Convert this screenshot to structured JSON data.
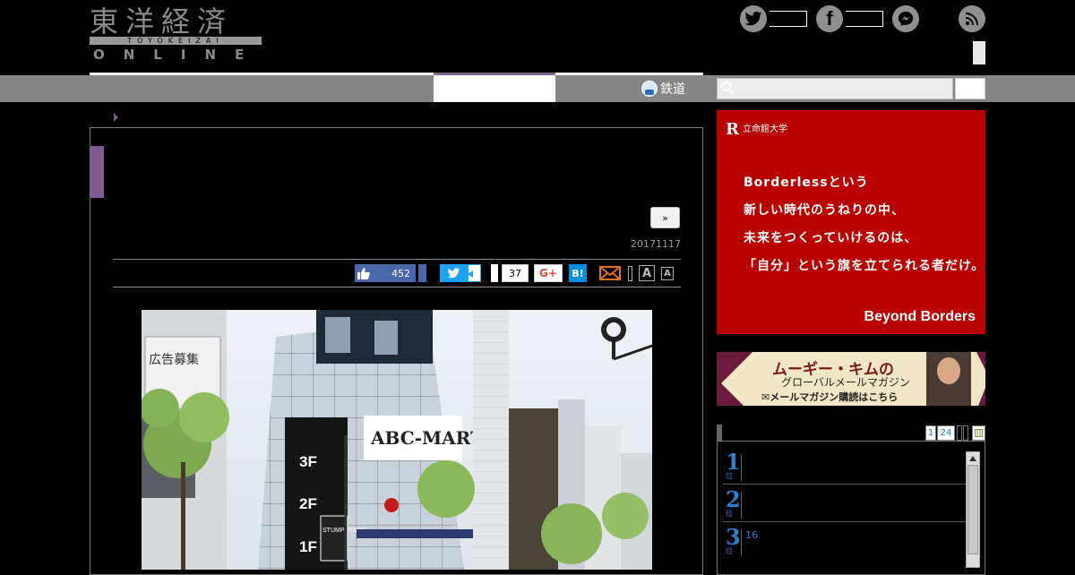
{
  "header": {
    "logo_kanji": "東洋経済",
    "logo_band": "TOYOKEIZAI",
    "logo_online": "ONLINE"
  },
  "social": {
    "twitter_icon": "twitter-icon",
    "facebook_icon": "facebook-icon",
    "messenger_icon": "messenger-icon",
    "rss_icon": "rss-icon"
  },
  "nav": {
    "rail_label": "鉄道",
    "search_placeholder": ""
  },
  "article": {
    "more_label": "»",
    "date": "20171117"
  },
  "share": {
    "like_count": "452",
    "hatena_count": "37",
    "gplus_label": "G+",
    "hatena_label": "B!",
    "font_large": "A",
    "font_small": "A"
  },
  "ads": {
    "ritsumei": {
      "logo_mark": "R",
      "logo_name": "立命館大学",
      "copy": [
        "Borderlessという",
        "新しい時代のうねりの中、",
        "未来をつくっていけるのは、",
        "「自分」という旗を立てられる者だけ。"
      ],
      "footer": "Beyond Borders"
    },
    "kim": {
      "line1": "ムーギー・キムの",
      "line2": "グローバルメールマガジン",
      "line3": "✉メールマガジン購読はこちら"
    }
  },
  "ranking": {
    "tabs": [
      "1",
      "24"
    ],
    "items": [
      {
        "num": "1",
        "sub": "位",
        "text": ""
      },
      {
        "num": "2",
        "sub": "位",
        "text": ""
      },
      {
        "num": "3",
        "sub": "位",
        "text": "16"
      }
    ]
  },
  "photo": {
    "sign_left": "広告募集",
    "store_name": "ABC-MART",
    "floor_3": "3F",
    "floor_2": "2F",
    "floor_1": "1F",
    "stump": "STUMP TOWN"
  }
}
